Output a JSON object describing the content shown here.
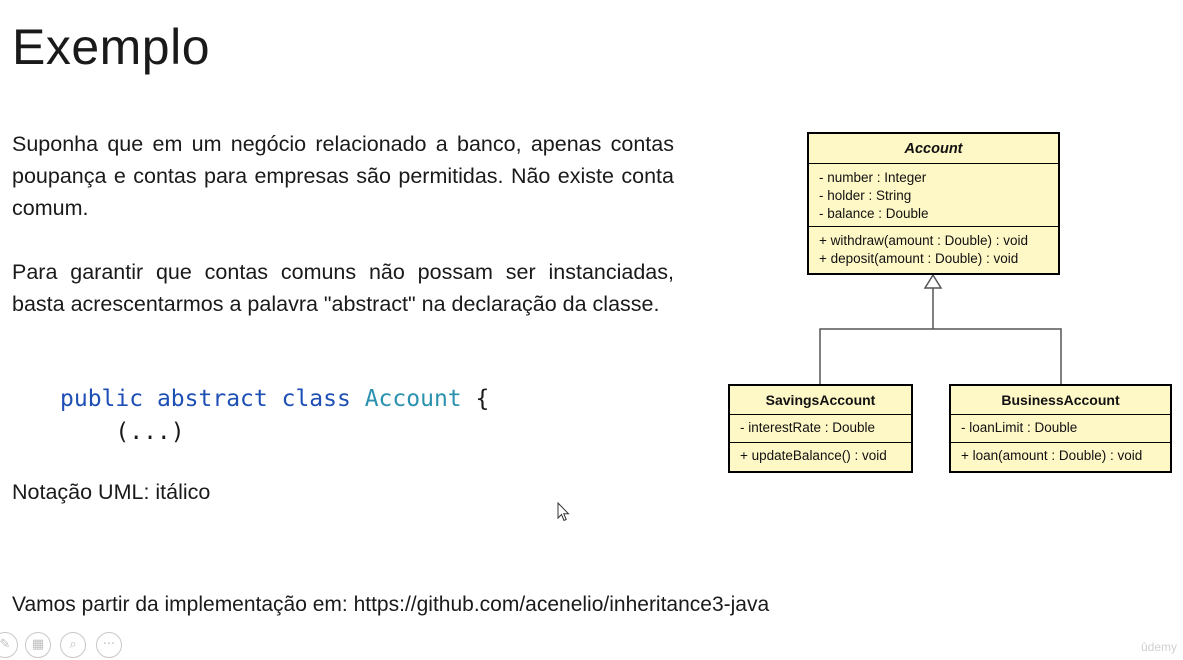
{
  "slide": {
    "title": "Exemplo",
    "paragraph1": "Suponha que em um negócio relacionado a banco, apenas contas poupança e contas para empresas são permitidas. Não existe conta comum.",
    "paragraph2": "Para garantir que contas comuns não possam ser instanciadas, basta acrescentarmos a palavra \"abstract\" na declaração da classe.",
    "code": {
      "kw_public": "public",
      "kw_abstract": "abstract",
      "kw_class": "class",
      "class_name": "Account",
      "open_brace": "{",
      "body": "(...)"
    },
    "notation": "Notação UML: itálico",
    "footer": "Vamos partir da implementação em: https://github.com/acenelio/inheritance3-java"
  },
  "uml": {
    "account": {
      "name": "Account",
      "attributes": [
        "- number : Integer",
        "- holder : String",
        "- balance : Double"
      ],
      "operations": [
        "+ withdraw(amount : Double) : void",
        "+ deposit(amount : Double) : void"
      ]
    },
    "savings": {
      "name": "SavingsAccount",
      "attributes": [
        "- interestRate : Double"
      ],
      "operations": [
        "+ updateBalance() : void"
      ]
    },
    "business": {
      "name": "BusinessAccount",
      "attributes": [
        "- loanLimit : Double"
      ],
      "operations": [
        "+ loan(amount : Double) : void"
      ]
    }
  },
  "controls": {
    "icons": [
      "pen-icon",
      "slides-icon",
      "zoom-icon",
      "more-icon"
    ]
  },
  "branding": "ûdemy",
  "colors": {
    "uml_fill": "#fef7c6",
    "code_keyword": "#1e4fb5",
    "code_class": "#2b91af"
  }
}
